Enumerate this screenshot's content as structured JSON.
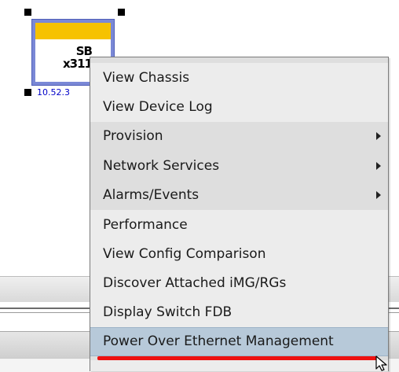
{
  "device": {
    "name_line1": "SB",
    "name_line2": "x311",
    "ip": "10.52.3",
    "status_color": "#f6c200",
    "selection_color": "#7a88d6"
  },
  "context_menu": {
    "items": [
      {
        "label": "View Chassis",
        "submenu": false
      },
      {
        "label": "View Device Log",
        "submenu": false
      },
      {
        "label": "Provision",
        "submenu": true
      },
      {
        "label": "Network Services",
        "submenu": true
      },
      {
        "label": "Alarms/Events",
        "submenu": true
      },
      {
        "label": "Performance",
        "submenu": false
      },
      {
        "label": "View Config Comparison",
        "submenu": false
      },
      {
        "label": "Discover Attached iMG/RGs",
        "submenu": false
      },
      {
        "label": "Display Switch FDB",
        "submenu": false
      },
      {
        "label": "Power Over Ethernet Management",
        "submenu": false,
        "highlighted": true
      }
    ],
    "highlight_color": "#b7c9d9",
    "underline_color": "#ee1111"
  },
  "cursor": {
    "icon": "arrow-pointer-icon"
  }
}
